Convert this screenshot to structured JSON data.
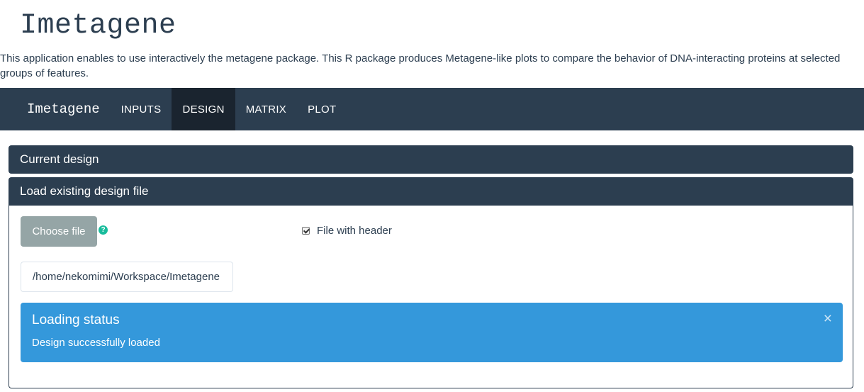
{
  "app": {
    "title": "Imetagene",
    "description": "This application enables to use interactively the metagene package. This R package produces Metagene-like plots to compare the behavior of DNA-interacting proteins at selected groups of features."
  },
  "navbar": {
    "brand": "Imetagene",
    "items": [
      {
        "label": "INPUTS",
        "active": false
      },
      {
        "label": "DESIGN",
        "active": true
      },
      {
        "label": "MATRIX",
        "active": false
      },
      {
        "label": "PLOT",
        "active": false
      }
    ]
  },
  "panels": {
    "current_design": {
      "title": "Current design"
    },
    "load_design": {
      "title": "Load existing design file",
      "choose_file_label": "Choose file",
      "help_icon": "question-circle-icon",
      "help_glyph": "?",
      "header_checkbox": {
        "label": "File with header",
        "checked": true
      },
      "file_path": "/home/nekomimi/Workspace/Imetagene"
    }
  },
  "alert": {
    "title": "Loading status",
    "message": "Design successfully loaded",
    "close_glyph": "×"
  },
  "colors": {
    "primary": "#2c3e50",
    "info": "#3498db",
    "success": "#18bc9c",
    "default_button": "#95a5a6"
  }
}
